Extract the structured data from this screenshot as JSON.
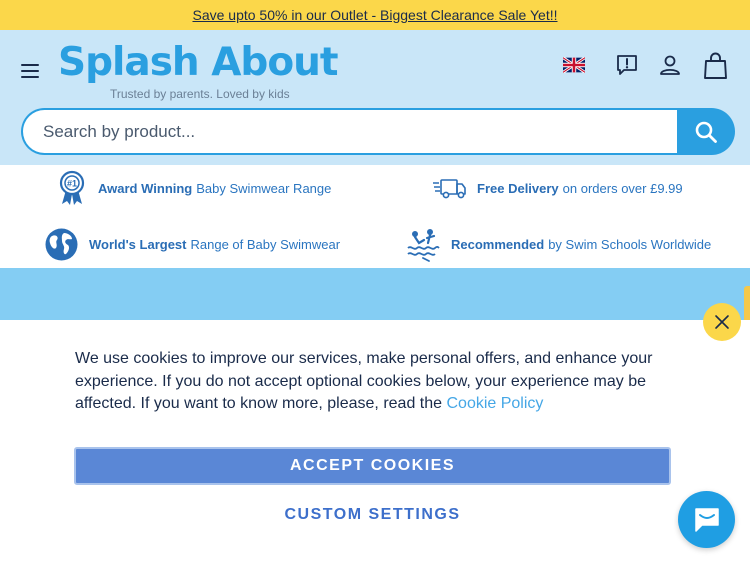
{
  "promo": {
    "text": "Save upto 50% in our Outlet - Biggest Clearance Sale Yet!!"
  },
  "header": {
    "logo_text": "Splash About",
    "logo_tagline": "Trusted by parents. Loved by kids"
  },
  "search": {
    "placeholder": "Search by product..."
  },
  "usps": [
    {
      "bold": "Award Winning",
      "text": "Baby Swimwear Range",
      "icon": "award-rosette-icon"
    },
    {
      "bold": "Free Delivery",
      "text": "on orders over £9.99",
      "icon": "delivery-truck-icon"
    },
    {
      "bold": "World's Largest",
      "text": "Range of Baby Swimwear",
      "icon": "globe-icon"
    },
    {
      "bold": "Recommended",
      "text": "by Swim Schools Worldwide",
      "icon": "swim-school-icon"
    }
  ],
  "cookie": {
    "message": "We use cookies to improve our services, make personal offers, and enhance your experience. If you do not accept optional cookies below, your experience may be affected. If you want to know more, please, read the",
    "policy_link": "Cookie Policy",
    "accept_label": "ACCEPT COOKIES",
    "custom_label": "CUSTOM SETTINGS"
  },
  "colors": {
    "promo_bg": "#fbd74a",
    "header_bg": "#c9e6f8",
    "brand_blue": "#2a9fe0",
    "accept_btn": "#5a87d6",
    "banner_bg": "#84cdf3"
  }
}
